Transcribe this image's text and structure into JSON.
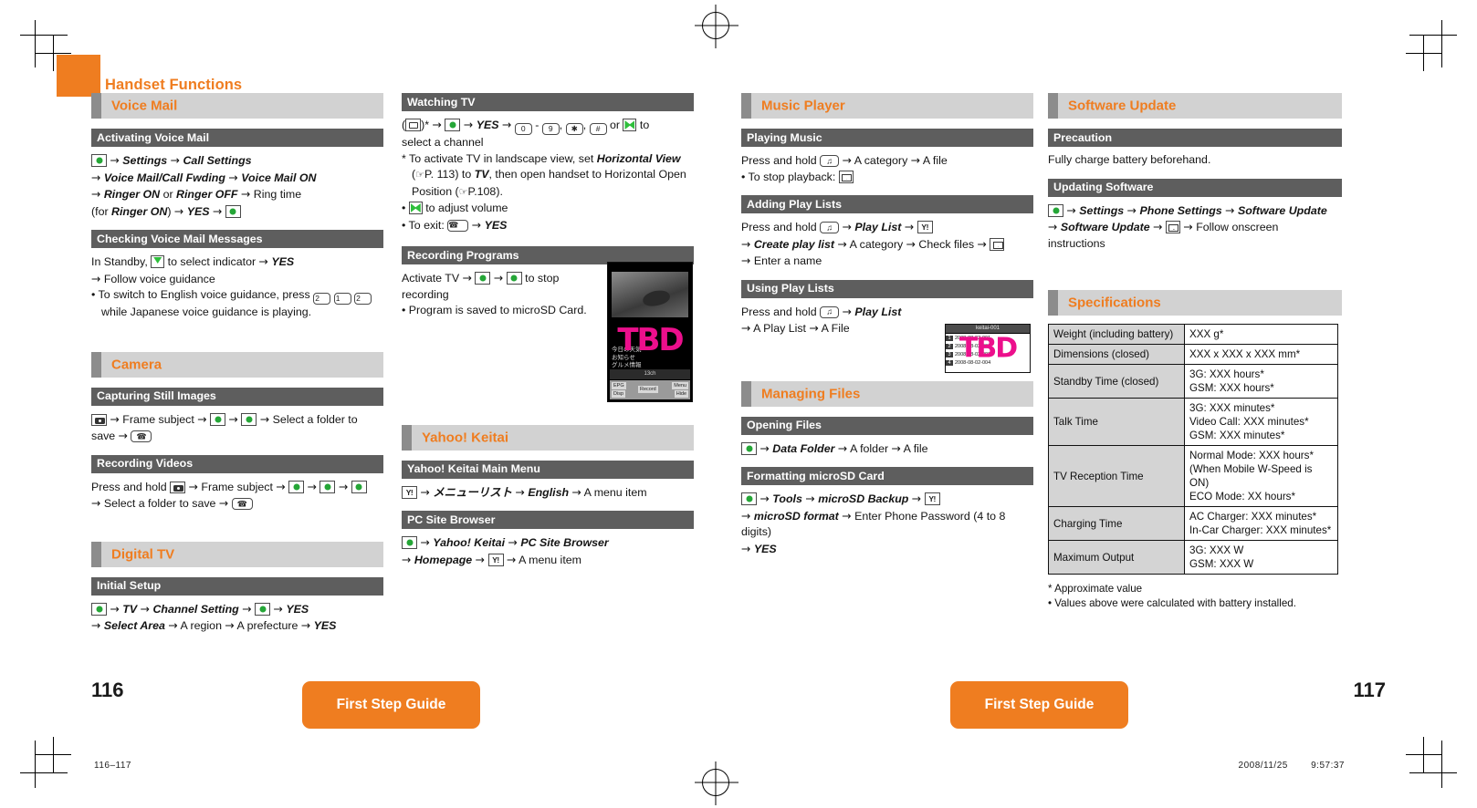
{
  "chapter": {
    "title": "Handset Functions"
  },
  "footer": {
    "page_left": "116",
    "page_right": "117",
    "guide_label": "First Step Guide",
    "slug_left": "116–117",
    "slug_date": "2008/11/25",
    "slug_time": "9:57:37"
  },
  "col1": {
    "sections": [
      {
        "title": "Voice Mail",
        "subs": [
          {
            "title": "Activating Voice Mail",
            "lines": [
              "[center] → Settings → Call Settings",
              "→ Voice Mail/Call Fwding → Voice Mail ON",
              "→ Ringer ON or Ringer OFF → Ring time",
              "(for Ringer ON) → YES → [center]"
            ]
          },
          {
            "title": "Checking Voice Mail Messages",
            "lines": [
              "In Standby, [down] to select indicator → YES",
              "→ Follow voice guidance",
              "• To switch to English voice guidance, press [2] [1] [2] while Japanese voice guidance is playing."
            ]
          }
        ]
      },
      {
        "title": "Camera",
        "subs": [
          {
            "title": "Capturing Still Images",
            "lines": [
              "[camera] → Frame subject → [center] → [center] → Select a folder to save → [end]"
            ]
          },
          {
            "title": "Recording Videos",
            "lines": [
              "Press and hold [camera] → Frame subject → [center] → [center] → [center]",
              "→ Select a folder to save → [end]"
            ]
          }
        ]
      },
      {
        "title": "Digital TV",
        "subs": [
          {
            "title": "Initial Setup",
            "lines": [
              "[center] → TV → Channel Setting → [center] → YES",
              "→ Select Area → A region → A prefecture → YES"
            ]
          }
        ]
      }
    ]
  },
  "col2": {
    "watching_tv": {
      "title": "Watching TV",
      "line1": "([tv])* → [center] → YES → [0] - [9], [*], [#] or [nav] to select a channel",
      "note_star": "* To activate TV in landscape view, set Horizontal View (☞P. 113) to TV, then open handset to Horizontal Open Position (☞P.108).",
      "bullet1": "• [nav] to adjust volume",
      "bullet2": "• To exit: [end] → YES"
    },
    "recording": {
      "title": "Recording Programs",
      "line1": "Activate TV → [center] → [center] to stop recording",
      "bullet1": "• Program is saved to microSD Card."
    },
    "tv_shot": {
      "tbd": "TBD",
      "line1": "今日の天気",
      "line2": "お知らせ",
      "line3": "グルメ情報",
      "status": "13ch",
      "sk_left": "EPG",
      "sk_left2": "Disp",
      "sk_center": "Record",
      "sk_right": "Menu",
      "sk_right2": "Hide"
    },
    "yahoo": {
      "title": "Yahoo! Keitai",
      "subs": [
        {
          "title": "Yahoo! Keitai Main Menu",
          "lines": [
            "[yahoo] → メニューリスト → English → A menu item"
          ]
        },
        {
          "title": "PC Site Browser",
          "lines": [
            "[center] → Yahoo! Keitai → PC Site Browser",
            "→ Homepage → [yahoo] → A menu item"
          ]
        }
      ]
    }
  },
  "col3": {
    "music": {
      "title": "Music Player",
      "subs": [
        {
          "title": "Playing Music",
          "lines": [
            "Press and hold [music] → A category → A file",
            "• To stop playback: [mail]"
          ]
        },
        {
          "title": "Adding Play Lists",
          "lines": [
            "Press and hold [music] → Play List → [yahoo]",
            "→ Create play list → A category → Check files → [mail]",
            "→ Enter a name"
          ]
        },
        {
          "title": "Using Play Lists",
          "lines": [
            "Press and hold [music] → Play List",
            "→ A Play List → A File"
          ]
        }
      ]
    },
    "mus_shot": {
      "tbd": "TBD",
      "header": "keitai-001",
      "rows": [
        {
          "n": "1",
          "t": "2008-08-02-001"
        },
        {
          "n": "2",
          "t": "2008-08-02-002"
        },
        {
          "n": "3",
          "t": "2008-08-02-003"
        },
        {
          "n": "4",
          "t": "2008-08-02-004"
        }
      ]
    },
    "files": {
      "title": "Managing Files",
      "subs": [
        {
          "title": "Opening Files",
          "lines": [
            "[center] → Data Folder → A folder → A file"
          ]
        },
        {
          "title": "Formatting microSD Card",
          "lines": [
            "[center] → Tools → microSD Backup → [yahoo]",
            "→ microSD format → Enter Phone Password (4 to 8 digits)",
            "→ YES"
          ]
        }
      ]
    }
  },
  "col4": {
    "software": {
      "title": "Software Update",
      "subs": [
        {
          "title": "Precaution",
          "lines": [
            "Fully charge battery beforehand."
          ]
        },
        {
          "title": "Updating Software",
          "lines": [
            "[center] → Settings → Phone Settings → Software Update",
            "→ Software Update → [mail] → Follow onscreen instructions"
          ]
        }
      ]
    },
    "specifications": {
      "title": "Specifications",
      "rows": [
        {
          "key": "Weight (including battery)",
          "value": "XXX g*"
        },
        {
          "key": "Dimensions (closed)",
          "value": "XXX x XXX x XXX mm*"
        },
        {
          "key": "Standby Time (closed)",
          "value": "3G: XXX hours*\nGSM: XXX hours*"
        },
        {
          "key": "Talk Time",
          "value": "3G: XXX minutes*\nVideo Call: XXX minutes*\nGSM: XXX minutes*"
        },
        {
          "key": "TV Reception Time",
          "value": "Normal Mode: XXX hours*\n(When Mobile W-Speed is ON)\nECO Mode: XX hours*"
        },
        {
          "key": "Charging Time",
          "value": "AC Charger: XXX minutes*\nIn-Car Charger: XXX minutes*"
        },
        {
          "key": "Maximum Output",
          "value": "3G: XXX W\nGSM: XXX W"
        }
      ],
      "note_star": "*  Approximate value",
      "note_bullet": "• Values above were calculated with battery installed."
    }
  },
  "colors": {
    "orange": "#ef7d20",
    "section_grey": "#d2d2d2",
    "sub_grey": "#5e5e5e",
    "tbd_pink": "#ec0f8c"
  }
}
